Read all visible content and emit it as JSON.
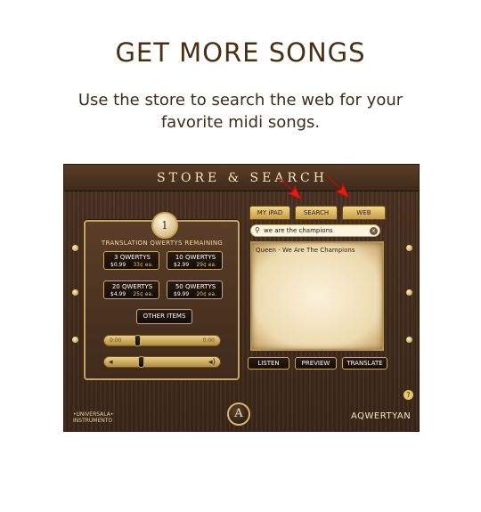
{
  "headline": "GET MORE SONGS",
  "subtitle": "Use the store to search the web for your favorite midi songs.",
  "app": {
    "title": "STORE & SEARCH",
    "tabs": [
      "MY iPAD",
      "SEARCH",
      "WEB"
    ],
    "badge": "1",
    "remaining_label": "TRANSLATION QWERTYS REMAINING",
    "packs": [
      {
        "name": "3 QWERTYS",
        "price": "$0.99",
        "each": "33¢ ea."
      },
      {
        "name": "10 QWERTYS",
        "price": "$2.99",
        "each": "29¢ ea."
      },
      {
        "name": "20 QWERTYS",
        "price": "$4.99",
        "each": "25¢ ea."
      },
      {
        "name": "50 QWERTYS",
        "price": "$9.99",
        "each": "20¢ ea."
      }
    ],
    "other_items": "OTHER ITEMS",
    "playback": {
      "start_time": "0:00",
      "end_time": "0:00",
      "progress": 0.15
    },
    "volume": {
      "level": 0.2
    },
    "search_query": "we are the champions",
    "results": [
      "Queen - We Are The Champions"
    ],
    "buttons": [
      "LISTEN",
      "PREVIEW",
      "TRANSLATE"
    ],
    "help": "?",
    "logo_letter": "A",
    "brand_left": [
      "•UNIVERSALA•",
      "INSTRUMENTO"
    ],
    "brand_right": "AQWERTYAN",
    "annotation_color": "#e21c1c"
  }
}
